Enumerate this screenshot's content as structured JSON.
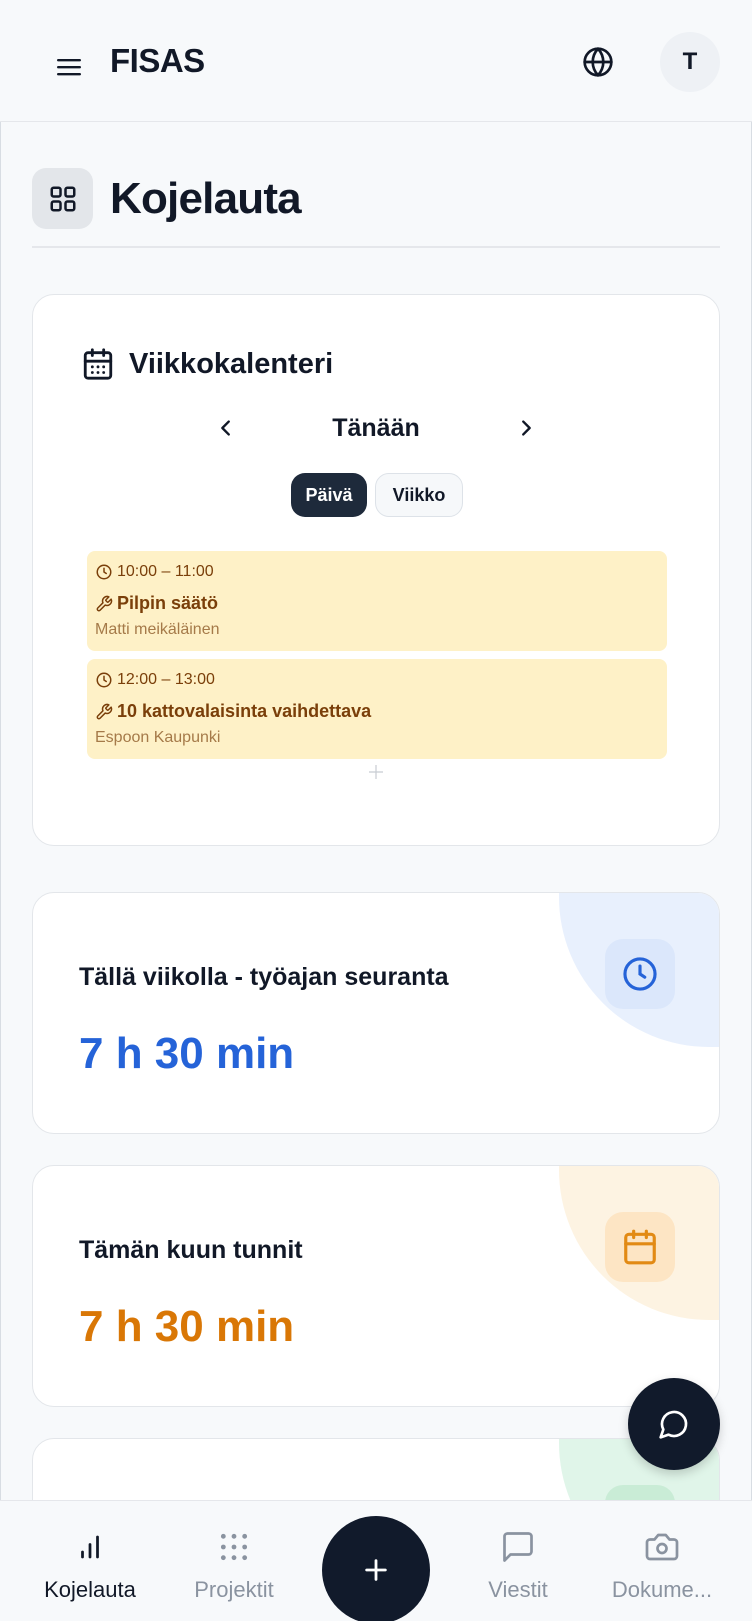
{
  "header": {
    "app_title": "FISAS",
    "avatar_initial": "T"
  },
  "page": {
    "title": "Kojelauta"
  },
  "calendar": {
    "title": "Viikkokalenteri",
    "current_label": "Tänään",
    "view_day": "Päivä",
    "view_week": "Viikko",
    "events": [
      {
        "time": "10:00 – 11:00",
        "title": "Pilpin säätö",
        "client": "Matti meikäläinen"
      },
      {
        "time": "12:00 – 13:00",
        "title": "10 kattovalaisinta vaihdettava",
        "client": "Espoon Kaupunki"
      }
    ]
  },
  "stats": [
    {
      "label": "Tällä viikolla - työajan seuranta",
      "value": "7 h 30 min",
      "color": "#2563d8",
      "icon": "clock-icon"
    },
    {
      "label": "Tämän kuun tunnit",
      "value": "7 h 30 min",
      "color": "#d97706",
      "icon": "calendar-icon"
    }
  ],
  "bottom_nav": {
    "items": [
      {
        "label": "Kojelauta",
        "icon": "bar-chart-icon",
        "active": true
      },
      {
        "label": "Projektit",
        "icon": "grid-dots-icon",
        "active": false
      },
      {
        "label": "Viestit",
        "icon": "message-icon",
        "active": false
      },
      {
        "label": "Dokume...",
        "icon": "camera-icon",
        "active": false
      }
    ]
  },
  "colors": {
    "primary_dark": "#111a2b",
    "event_bg": "#fef1c7",
    "event_text": "#7a3f0a"
  }
}
